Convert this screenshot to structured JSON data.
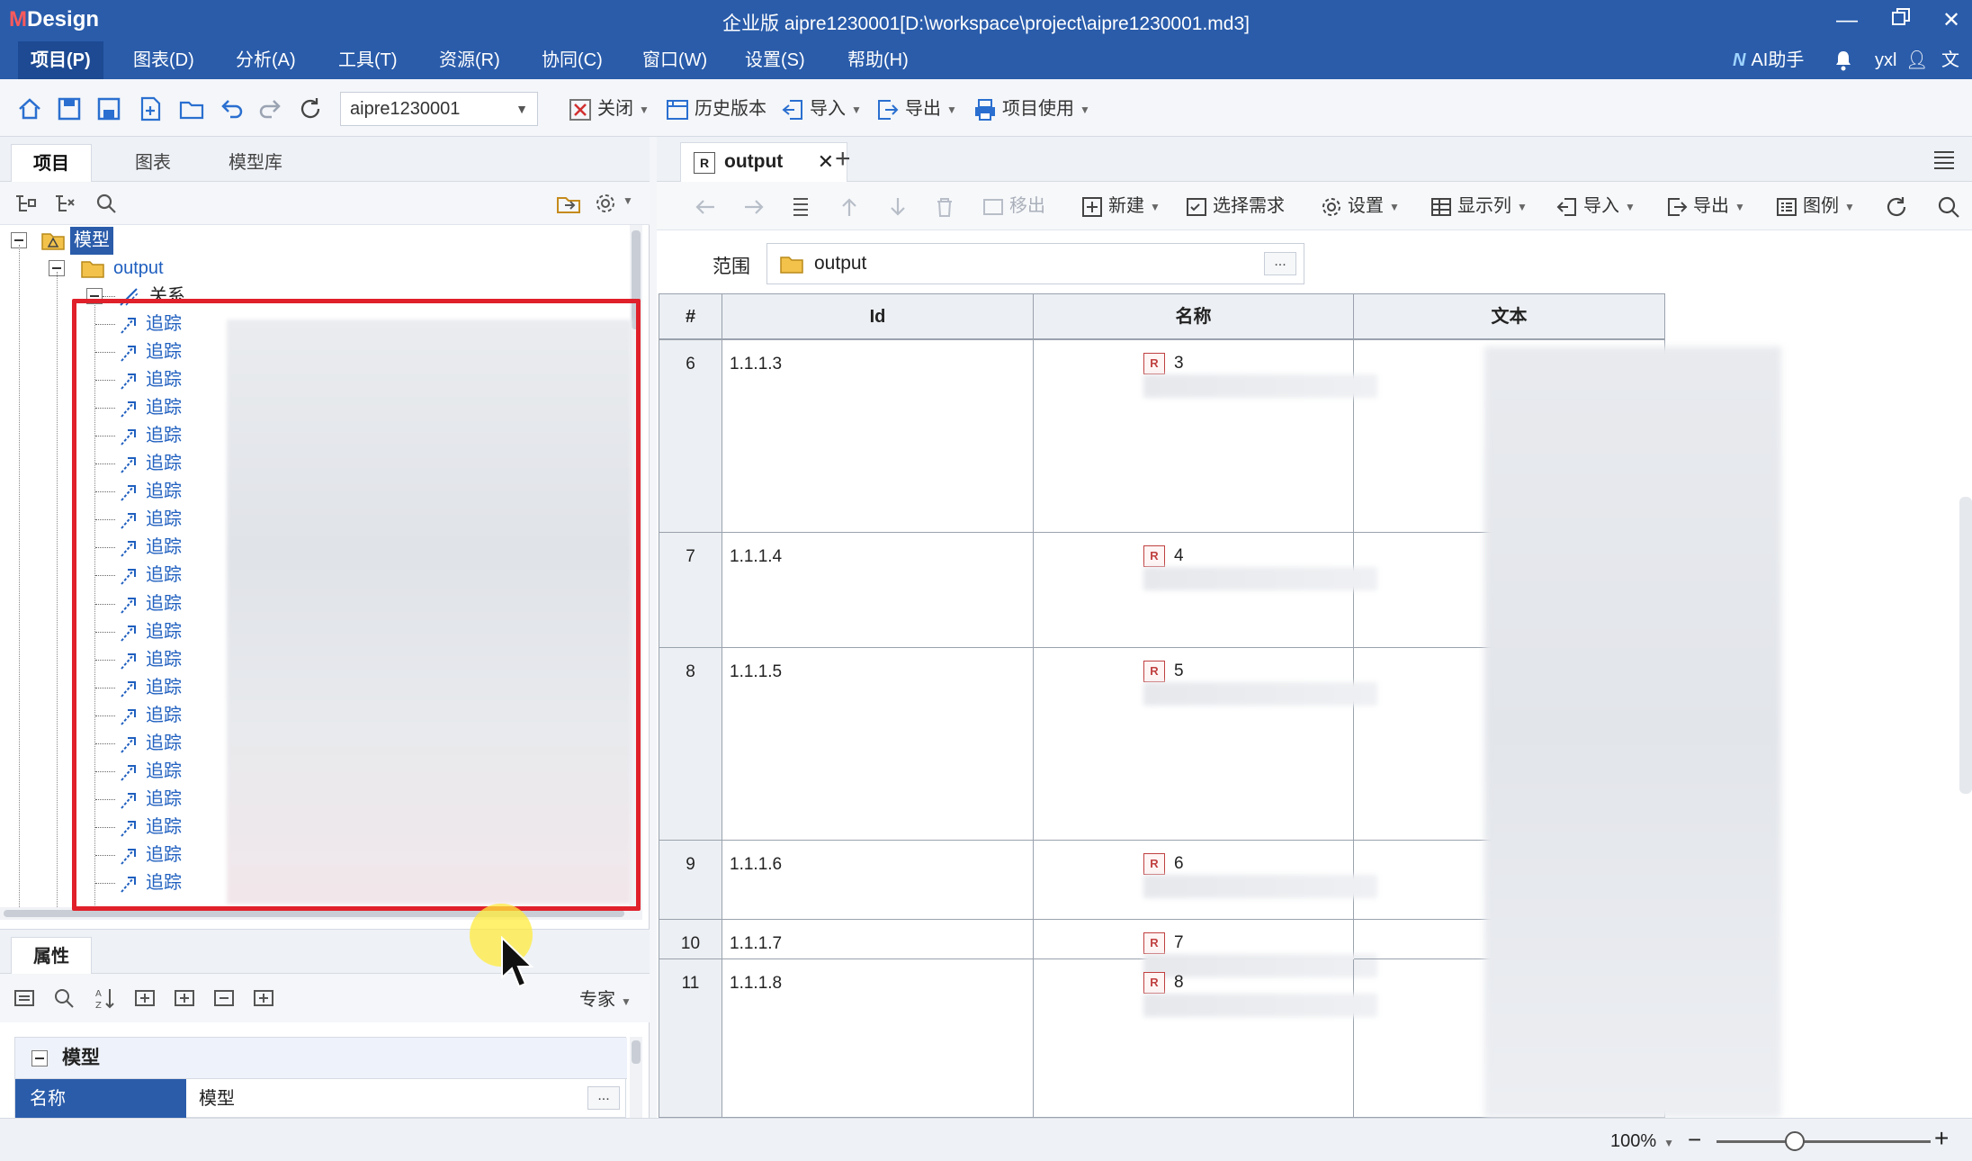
{
  "app": {
    "logo_m": "M",
    "logo_rest": "Design",
    "title": "企业版  aipre1230001[D:\\workspace\\project\\aipre1230001.md3]"
  },
  "menu": {
    "items": [
      "项目(P)",
      "图表(D)",
      "分析(A)",
      "工具(T)",
      "资源(R)",
      "协同(C)",
      "窗口(W)",
      "设置(S)",
      "帮助(H)"
    ],
    "ai": "AI助手",
    "user": "yxl"
  },
  "toolbar": {
    "project_select": "aipre1230001",
    "close": "关闭",
    "history": "历史版本",
    "import": "导入",
    "export": "导出",
    "project_use": "项目使用"
  },
  "left_tabs": [
    "项目",
    "图表",
    "模型库"
  ],
  "tree": {
    "root": "模型",
    "folder": "output",
    "relations": "关系",
    "trace_label": "追踪",
    "trace_count": 21
  },
  "properties": {
    "tab": "属性",
    "mode": "专家",
    "group": "模型",
    "name_key": "名称",
    "name_value": "模型",
    "ellipsis": "..."
  },
  "doc": {
    "tab_label": "output",
    "tab_icon": "R",
    "add": "+"
  },
  "right_toolbar": {
    "move_out": "移出",
    "new": "新建",
    "select_req": "选择需求",
    "settings": "设置",
    "show_cols": "显示列",
    "import": "导入",
    "export": "导出",
    "legend": "图例"
  },
  "scope": {
    "label": "范围",
    "value": "output",
    "ellipsis": "..."
  },
  "table": {
    "columns": [
      "#",
      "Id",
      "名称",
      "文本"
    ],
    "rows": [
      {
        "num": "6",
        "id": "1.1.1.3",
        "name_prefix": "3"
      },
      {
        "num": "7",
        "id": "1.1.1.4",
        "name_prefix": "4"
      },
      {
        "num": "8",
        "id": "1.1.1.5",
        "name_prefix": "5"
      },
      {
        "num": "9",
        "id": "1.1.1.6",
        "name_prefix": "6"
      },
      {
        "num": "10",
        "id": "1.1.1.7",
        "name_prefix": "7"
      },
      {
        "num": "11",
        "id": "1.1.1.8",
        "name_prefix": "8"
      }
    ],
    "badge": "R"
  },
  "status": {
    "zoom": "100%"
  },
  "colors": {
    "brand": "#2a5caa",
    "highlight": "#e0202a",
    "trace": "#1f5fbf"
  }
}
